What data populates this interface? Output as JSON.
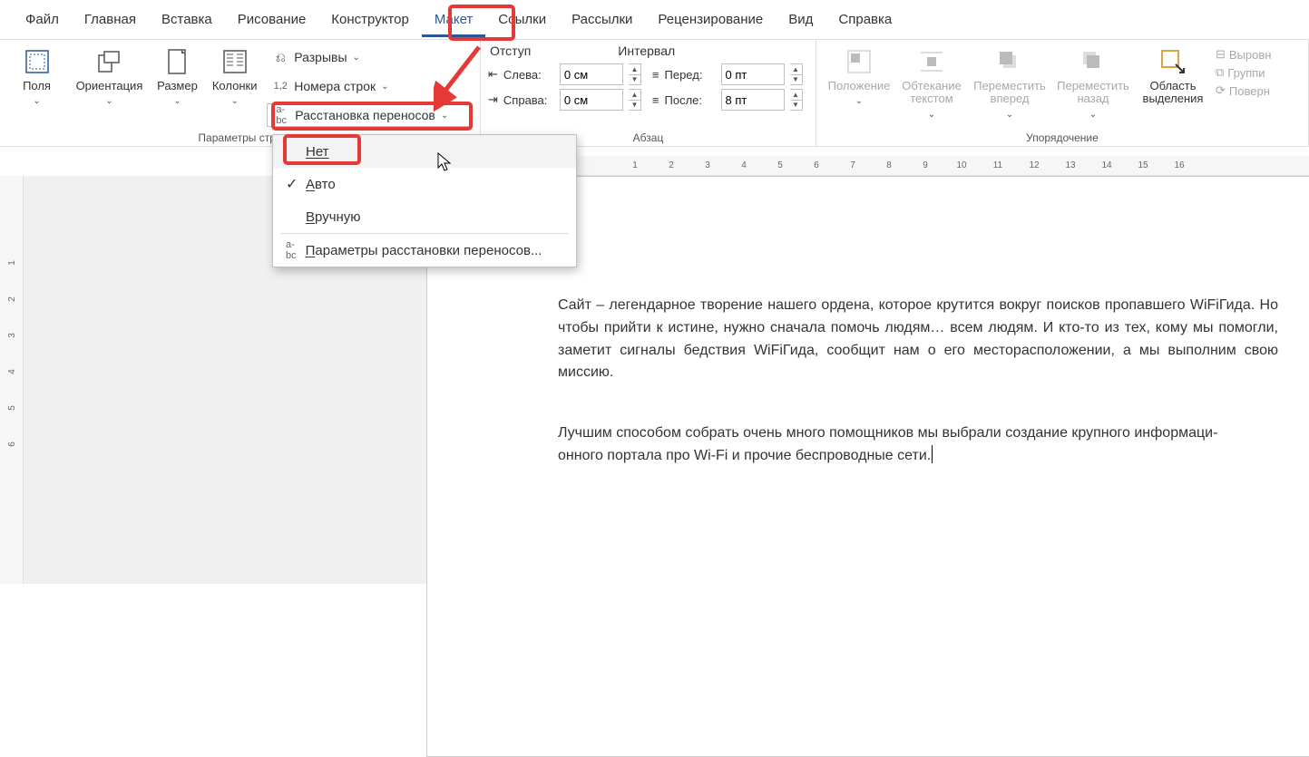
{
  "menu": {
    "file": "Файл",
    "home": "Главная",
    "insert": "Вставка",
    "draw": "Рисование",
    "design": "Конструктор",
    "layout": "Макет",
    "references": "Ссылки",
    "mailings": "Рассылки",
    "review": "Рецензирование",
    "view": "Вид",
    "help": "Справка"
  },
  "ribbon": {
    "page_setup": {
      "margins": "Поля",
      "orientation": "Ориентация",
      "size": "Размер",
      "columns": "Колонки",
      "breaks": "Разрывы",
      "line_numbers": "Номера строк",
      "hyphenation": "Расстановка переносов",
      "group_label": "Параметры стра"
    },
    "indent": {
      "title": "Отступ",
      "left_label": "Слева:",
      "right_label": "Справа:",
      "left_value": "0 см",
      "right_value": "0 см"
    },
    "spacing": {
      "title": "Интервал",
      "before_label": "Перед:",
      "after_label": "После:",
      "before_value": "0 пт",
      "after_value": "8 пт",
      "group_label": "Абзац"
    },
    "arrange": {
      "position": "Положение",
      "wrap": "Обтекание текстом",
      "forward": "Переместить вперед",
      "backward": "Переместить назад",
      "selection": "Область выделения",
      "align": "Выровн",
      "group": "Группи",
      "rotate": "Поверн",
      "group_label": "Упорядочение"
    }
  },
  "dropdown": {
    "none": "Нет",
    "auto": "Авто",
    "manual": "Вручную",
    "options": "Параметры расстановки переносов..."
  },
  "hruler": [
    " ",
    "1",
    "2",
    "3",
    "4",
    "5",
    "6",
    "7",
    "8",
    "9",
    "10",
    "11",
    "12",
    "13",
    "14",
    "15",
    "16"
  ],
  "vruler": [
    "",
    "1",
    "2",
    "3",
    "4",
    "5",
    "6"
  ],
  "doc": {
    "p1": "Сайт – легендарное творение нашего ордена, которое крутится вокруг поисков пропавшего WiFiГида. Но чтобы прийти к истине, нужно сначала помочь людям… всем людям. И кто-то из тех, кому мы помогли, заметит сигналы бедствия WiFiГида, сообщит нам о его месторасположении, а мы выполним свою миссию.",
    "p2a": "Лучшим способом собрать очень много помощников мы выбрали создание крупного информаци-",
    "p2b": "онного портала про Wi-Fi и прочие беспроводные сети."
  }
}
